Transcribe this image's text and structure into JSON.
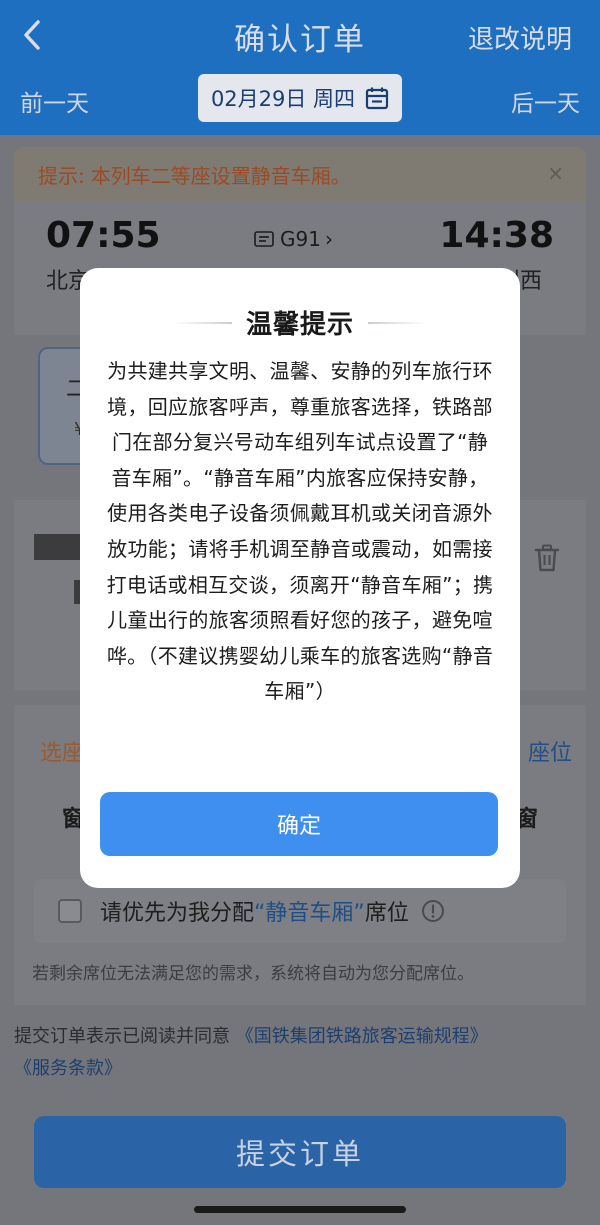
{
  "header": {
    "title": "确认订单",
    "refund_link": "退改说明",
    "prev_day": "前一天",
    "next_day": "后一天",
    "date": "02月29日 周四"
  },
  "tip": {
    "label": "提示:",
    "text": "本列车二等座设置静音车厢。",
    "close": "×"
  },
  "train": {
    "departure_time": "07:55",
    "arrival_time": "14:38",
    "departure_station": "北京西",
    "arrival_station": "兰州西",
    "number": "G91"
  },
  "seat_option": {
    "name": "二",
    "price": "¥"
  },
  "seat_select": {
    "title": "选座",
    "right_link": "座位",
    "left_window": "窗",
    "right_window": "窗"
  },
  "preference": {
    "text_before": "请优先为我分配",
    "highlight": "“静音车厢”",
    "text_after": "席位",
    "note": "若剩余席位无法满足您的需求，系统将自动为您分配席位。"
  },
  "agreement": {
    "prefix": "提交订单表示已阅读并同意",
    "link1": "《国铁集团铁路旅客运输规程》",
    "link2": "《服务条款》"
  },
  "submit_label": "提交订单",
  "modal": {
    "title": "温馨提示",
    "body": "为共建共享文明、温馨、安静的列车旅行环境，回应旅客呼声，尊重旅客选择，铁路部门在部分复兴号动车组列车试点设置了“静音车厢”。“静音车厢”内旅客应保持安静，使用各类电子设备须佩戴耳机或关闭音源外放功能；请将手机调至静音或震动，如需接打电话或相互交谈，须离开“静音车厢”；携儿童出行的旅客须照看好您的孩子，避免喧哗。（不建议携婴幼儿乘车的旅客选购“静音车厢”）",
    "confirm": "确定"
  }
}
